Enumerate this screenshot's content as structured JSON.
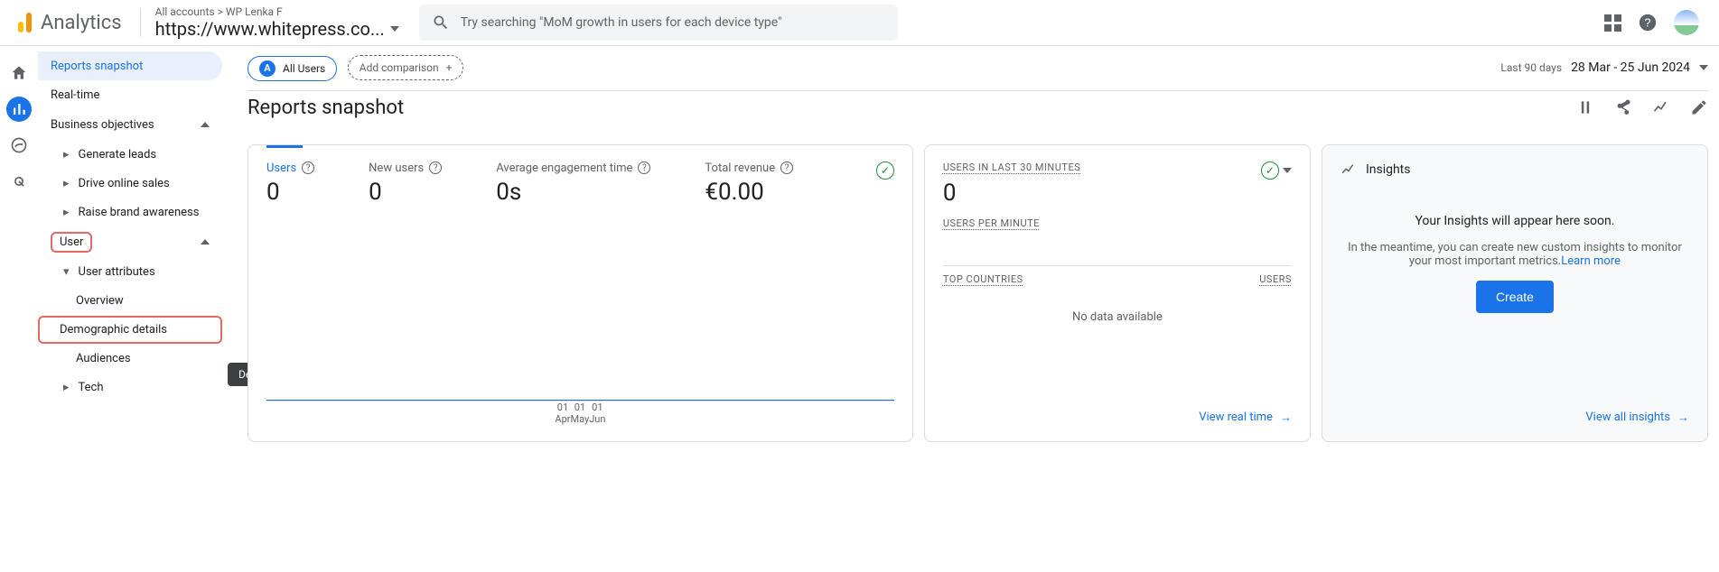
{
  "header": {
    "brand": "Analytics",
    "account_path": "All accounts > WP Lenka F",
    "property": "https://www.whitepress.co...",
    "search_placeholder": "Try searching \"MoM growth in users for each device type\""
  },
  "sidebar": {
    "items": [
      "Reports snapshot",
      "Real-time"
    ],
    "sections": [
      {
        "label": "Business objectives",
        "expanded": true,
        "items": [
          "Generate leads",
          "Drive online sales",
          "Raise brand awareness"
        ]
      },
      {
        "label": "User",
        "expanded": true,
        "highlight": true,
        "groups": [
          {
            "label": "User attributes",
            "items": [
              "Overview",
              "Demographic details",
              "Audiences"
            ]
          },
          {
            "label": "Tech",
            "items": []
          }
        ]
      }
    ]
  },
  "tooltip": "Demographic details",
  "filter": {
    "all_users": "All Users",
    "add_comparison": "Add comparison",
    "daterange_label": "Last 90 days",
    "daterange": "28 Mar - 25 Jun 2024"
  },
  "page_title": "Reports snapshot",
  "kpi": {
    "metrics": [
      {
        "label": "Users",
        "value": "0",
        "active": true
      },
      {
        "label": "New users",
        "value": "0"
      },
      {
        "label": "Average engagement time",
        "value": "0s"
      },
      {
        "label": "Total revenue",
        "value": "€0.00"
      }
    ],
    "xaxis": [
      "01\nApr",
      "01\nMay",
      "01\nJun"
    ]
  },
  "realtime": {
    "label": "USERS IN LAST 30 MINUTES",
    "value": "0",
    "upm_label": "USERS PER MINUTE",
    "topc_label": "TOP COUNTRIES",
    "users_label": "USERS",
    "nodata": "No data available",
    "link": "View real time"
  },
  "insights": {
    "title": "Insights",
    "soon": "Your Insights will appear here soon.",
    "desc": "In the meantime, you can create new custom insights to monitor your most important metrics.",
    "learn": "Learn more",
    "create": "Create",
    "link": "View all insights"
  },
  "chart_data": {
    "type": "line",
    "title": "Users",
    "x": [
      "01 Apr",
      "01 May",
      "01 Jun"
    ],
    "series": [
      {
        "name": "Users",
        "values": [
          0,
          0,
          0
        ]
      }
    ],
    "ylim": [
      0,
      1
    ]
  }
}
